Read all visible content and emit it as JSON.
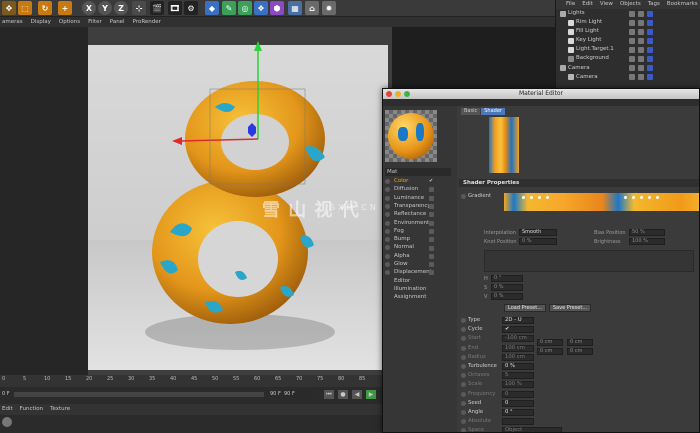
{
  "menubar": [
    "ameras",
    "Display",
    "Options",
    "Filter",
    "Panel",
    "ProRender"
  ],
  "toolbar_axes": [
    "X",
    "Y",
    "Z"
  ],
  "objects_menu": [
    "File",
    "Edit",
    "View",
    "Objects",
    "Tags",
    "Bookmarks"
  ],
  "objects": [
    {
      "name": "Lights",
      "indent": 0
    },
    {
      "name": "Rim Light",
      "indent": 1
    },
    {
      "name": "Fill Light",
      "indent": 1
    },
    {
      "name": "Key Light",
      "indent": 1
    },
    {
      "name": "Light.Target.1",
      "indent": 1
    },
    {
      "name": "Background",
      "indent": 1
    },
    {
      "name": "Camera",
      "indent": 0
    },
    {
      "name": "Camera",
      "indent": 1
    }
  ],
  "timeline": {
    "ticks": [
      "0",
      "5",
      "10",
      "15",
      "20",
      "25",
      "30",
      "35",
      "40",
      "45",
      "50",
      "55",
      "60",
      "65",
      "70",
      "75",
      "80",
      "85"
    ],
    "frame_left": "0 F",
    "frame_right": "90 F",
    "frame_field": "90 F"
  },
  "material_menu": [
    "Edit",
    "Function",
    "Texture"
  ],
  "material_editor": {
    "title": "Material Editor",
    "material_name": "Mat",
    "channels": [
      "Color",
      "Diffusion",
      "Luminance",
      "Transparency",
      "Reflectance",
      "Environment",
      "Fog",
      "Bump",
      "Normal",
      "Alpha",
      "Glow",
      "Displacement",
      "Editor",
      "Illumination",
      "Assignment"
    ],
    "tabs": [
      "Basic",
      "Shader"
    ],
    "section_title": "Shader Properties",
    "gradient_label": "Gradient",
    "interpolation_label": "Interpolation",
    "interpolation_value": "Smooth",
    "knot_position_label": "Knot Position",
    "knot_position_value": "0 %",
    "bias_position_label": "Bias Position",
    "bias_position_value": "50 %",
    "brightness_label": "Brightness",
    "brightness_value": "100 %",
    "load_preset": "Load Preset...",
    "save_preset": "Save Preset...",
    "h_label": "H",
    "h_value": "0 °",
    "s_label": "S",
    "s_value": "0 %",
    "v_label": "V",
    "v_value": "0 %",
    "props": [
      {
        "label": "Type",
        "value": "2D - U",
        "dim": false
      },
      {
        "label": "Cycle",
        "value": "✔",
        "dim": false
      },
      {
        "label": "Start",
        "value": "-100 cm",
        "dim": true
      },
      {
        "label": "End",
        "value": "100 cm",
        "dim": true
      },
      {
        "label": "Radius",
        "value": "100 cm",
        "dim": true
      },
      {
        "label": "Turbulence",
        "value": "0 %",
        "dim": false
      },
      {
        "label": "Octaves",
        "value": "5",
        "dim": true
      },
      {
        "label": "Scale",
        "value": "100 %",
        "dim": true
      },
      {
        "label": "Frequency",
        "value": "0",
        "dim": true
      },
      {
        "label": "Seed",
        "value": "0",
        "dim": false
      },
      {
        "label": "Angle",
        "value": "0 °",
        "dim": false
      },
      {
        "label": "Absolute",
        "value": "",
        "dim": true
      },
      {
        "label": "Space",
        "value": "Object",
        "dim": true
      }
    ],
    "start_cols": [
      "0 cm",
      "0 cm"
    ],
    "end_cols": [
      "0 cm",
      "0 cm"
    ]
  },
  "watermark": {
    "main": "雪 山 视 代",
    "sub": "SXD.CN"
  },
  "colors": {
    "accent": "#4a78b8",
    "orange": "#f3a61f",
    "blue": "#1c78c8"
  }
}
